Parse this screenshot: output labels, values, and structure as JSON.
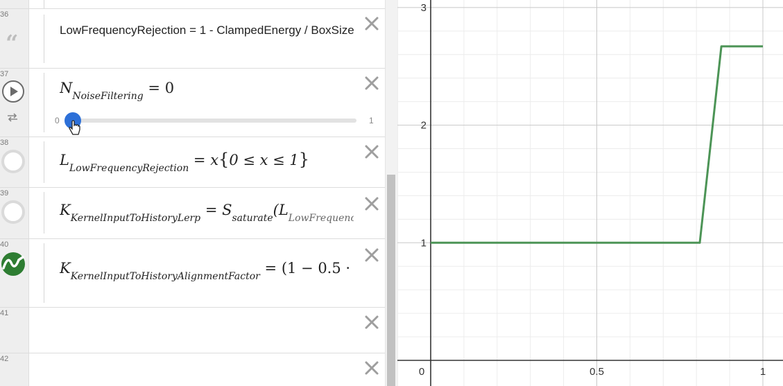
{
  "expressions": [
    {
      "num": "36",
      "text": "LowFrequencyRejection = 1 - ClampedEnergy / BoxSize"
    },
    {
      "num": "37",
      "lhs": "N",
      "sub": "NoiseFiltering",
      "rhs": "= 0",
      "slider": {
        "min": "0",
        "max": "1",
        "value": 0
      }
    },
    {
      "num": "38",
      "lhs": "L",
      "sub": "LowFrequencyRejection",
      "rhs_var": "= x",
      "cond": "0 ≤ x ≤ 1"
    },
    {
      "num": "39",
      "lhs": "K",
      "sub": "KernelInputToHistoryLerp",
      "rhs_var": "= S",
      "rhs_sub": "saturate",
      "rhs_tail": "(L",
      "rhs_tail_sub": "LowFrequenc"
    },
    {
      "num": "40",
      "lhs": "K",
      "sub": "KernelInputToHistoryAlignmentFactor",
      "rhs": "= (1 − 0.5 · "
    },
    {
      "num": "41"
    },
    {
      "num": "42"
    }
  ],
  "colors": {
    "curve": "#4c9456",
    "slider": "#2d70d8",
    "icon40": "#2e7d32"
  },
  "icons": {
    "row36": "quote-icon",
    "row37": "play-icon",
    "row37b": "loop-icon",
    "row38": "circle-icon",
    "row39": "circle-icon",
    "row40": "wave-icon"
  },
  "chart_data": {
    "type": "line",
    "xlim": [
      0,
      1
    ],
    "ylim": [
      0,
      3
    ],
    "xticks": [
      "0",
      "0.5",
      "1"
    ],
    "yticks": [
      "1",
      "2",
      "3"
    ],
    "grid": true,
    "series": [
      {
        "values": [
          [
            0,
            1
          ],
          [
            0.81,
            1
          ],
          [
            0.875,
            2.67
          ],
          [
            1,
            2.67
          ]
        ]
      }
    ]
  }
}
